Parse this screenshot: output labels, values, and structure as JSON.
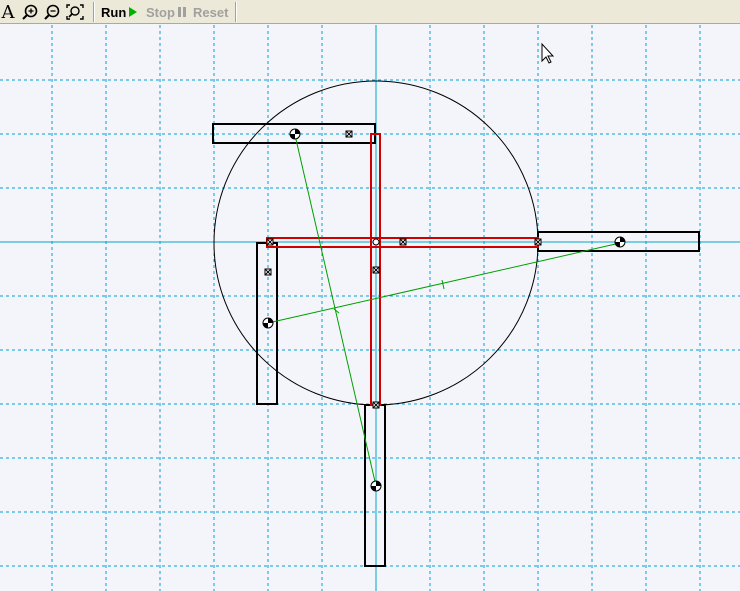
{
  "toolbar": {
    "text_tool_label": "A",
    "zoom_in_icon": "zoom-in-icon",
    "zoom_out_icon": "zoom-out-icon",
    "zoom_fit_icon": "zoom-fit-icon",
    "run_label": "Run",
    "stop_label": "Stop",
    "reset_label": "Reset"
  },
  "colors": {
    "background": "#f4f5fb",
    "grid": "#00a0d8",
    "axis": "#00a8c8",
    "body_outline": "#000000",
    "selected_body": "#d00000",
    "constraint_line": "#00a000",
    "run_icon": "#00b000",
    "disabled_text": "#a0a0a0"
  }
}
